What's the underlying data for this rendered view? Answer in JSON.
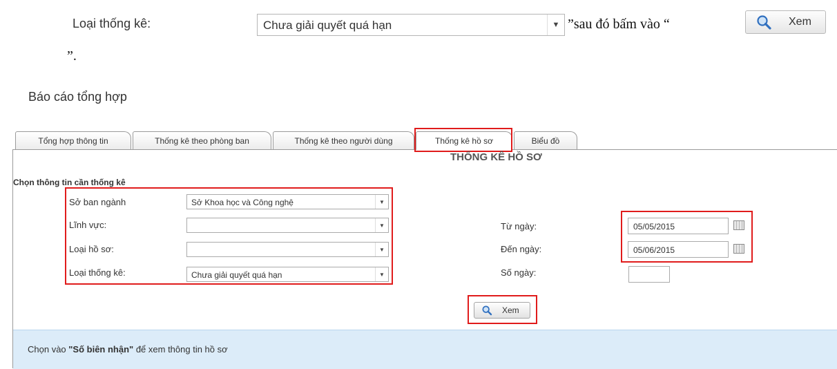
{
  "instruction": {
    "label": "Loại thống kê:",
    "select_value": "Chưa giải quyết quá hạn",
    "text_after": "”sau đó bấm vào “",
    "button_label": "Xem",
    "text_end": "”."
  },
  "report": {
    "title": "Báo cáo tổng hợp",
    "tabs": [
      "Tổng hợp thông tin",
      "Thống kê theo phòng ban",
      "Thống kê theo người dùng",
      "Thống kê hồ sơ",
      "Biểu đồ"
    ],
    "active_tab": "Thống kê hồ sơ",
    "heading": "THỐNG KÊ HỒ SƠ",
    "section_label": "Chọn thông tin cần thống kê",
    "fields": {
      "so_ban_nganh": {
        "label": "Sở ban ngành",
        "value": "Sở Khoa học và Công nghệ"
      },
      "linh_vuc": {
        "label": "Lĩnh vực:",
        "value": ""
      },
      "loai_ho_so": {
        "label": "Loại hồ sơ:",
        "value": ""
      },
      "loai_thong_ke": {
        "label": "Loại thống kê:",
        "value": "Chưa giải quyết quá hạn"
      }
    },
    "date_fields": {
      "tu_ngay": {
        "label": "Từ ngày:",
        "value": "05/05/2015"
      },
      "den_ngay": {
        "label": "Đến ngày:",
        "value": "05/06/2015"
      },
      "so_ngay": {
        "label": "Số ngày:",
        "value": ""
      }
    },
    "view_button": "Xem",
    "info": {
      "prefix": "Chọn vào ",
      "highlight": "\"Số biên nhận\"",
      "suffix": " để xem thông tin hồ sơ"
    }
  },
  "colors": {
    "highlight_border": "#e01b1b",
    "info_bg": "#dcecf9"
  },
  "icons": [
    "magnifier-icon",
    "dropdown-arrow-icon",
    "calendar-icon"
  ]
}
